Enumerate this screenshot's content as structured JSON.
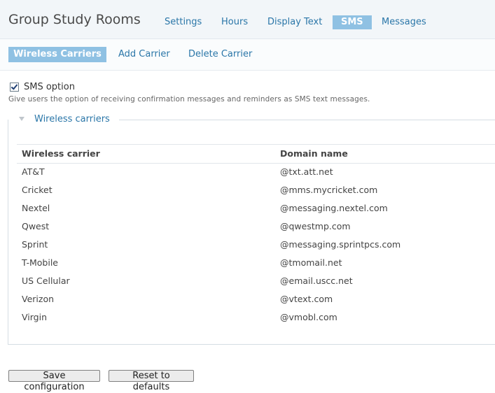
{
  "site_title": "Group Study Rooms",
  "primary_tabs": [
    "Settings",
    "Hours",
    "Display Text",
    "SMS",
    "Messages"
  ],
  "secondary_tabs": [
    "Wireless Carriers",
    "Add Carrier",
    "Delete Carrier"
  ],
  "sms_option": {
    "label": "SMS option",
    "checked": true,
    "description": "Give users the option of receiving confirmation messages and reminders as SMS text messages."
  },
  "fieldset": {
    "legend": "Wireless carriers"
  },
  "table": {
    "headers": [
      "Wireless carrier",
      "Domain name"
    ],
    "rows": [
      [
        "AT&T",
        "@txt.att.net"
      ],
      [
        "Cricket",
        "@mms.mycricket.com"
      ],
      [
        "Nextel",
        "@messaging.nextel.com"
      ],
      [
        "Qwest",
        "@qwestmp.com"
      ],
      [
        "Sprint",
        "@messaging.sprintpcs.com"
      ],
      [
        "T-Mobile",
        "@tmomail.net"
      ],
      [
        "US Cellular",
        "@email.uscc.net"
      ],
      [
        "Verizon",
        "@vtext.com"
      ],
      [
        "Virgin",
        "@vmobl.com"
      ]
    ]
  },
  "buttons": {
    "save": "Save configuration",
    "reset": "Reset to defaults"
  }
}
